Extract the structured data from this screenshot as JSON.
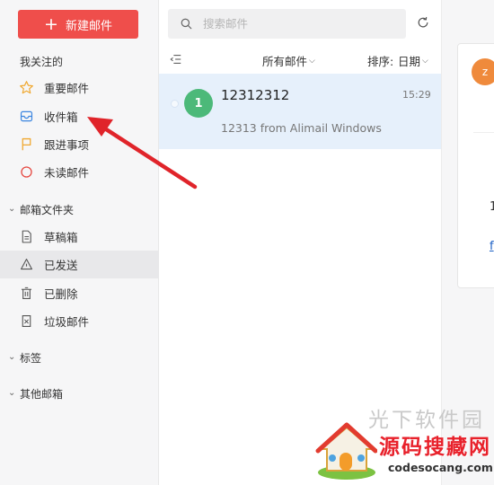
{
  "sidebar": {
    "compose_label": "新建邮件",
    "followed_title": "我关注的",
    "followed_items": [
      {
        "label": "重要邮件",
        "icon": "star-icon"
      },
      {
        "label": "收件箱",
        "icon": "inbox-icon"
      },
      {
        "label": "跟进事项",
        "icon": "flag-icon"
      },
      {
        "label": "未读邮件",
        "icon": "circle-icon"
      }
    ],
    "folders_title": "邮箱文件夹",
    "folder_items": [
      {
        "label": "草稿箱",
        "icon": "draft-icon"
      },
      {
        "label": "已发送",
        "icon": "send-icon",
        "active": true
      },
      {
        "label": "已删除",
        "icon": "trash-icon"
      },
      {
        "label": "垃圾邮件",
        "icon": "spam-icon"
      }
    ],
    "tags_title": "标签",
    "other_title": "其他邮箱"
  },
  "list": {
    "search_placeholder": "搜索邮件",
    "filter_label": "所有邮件",
    "sort_label": "排序:",
    "sort_value": "日期",
    "mail": {
      "avatar_text": "1",
      "sender": "12312312",
      "time": "15:29",
      "preview": "12313 from Alimail Windows"
    }
  },
  "reader": {
    "avatar_text": "z",
    "text_fragment": "1",
    "link_fragment": "f"
  },
  "watermark": {
    "grey_text": "光下软件园",
    "title": "源码搜藏网",
    "url": "codesocang.com"
  },
  "colors": {
    "accent": "#ef4e4b",
    "selected_row": "#e6f0fb",
    "avatar_green": "#4cb979",
    "avatar_orange": "#ef8a3c",
    "arrow": "#e0242a"
  }
}
